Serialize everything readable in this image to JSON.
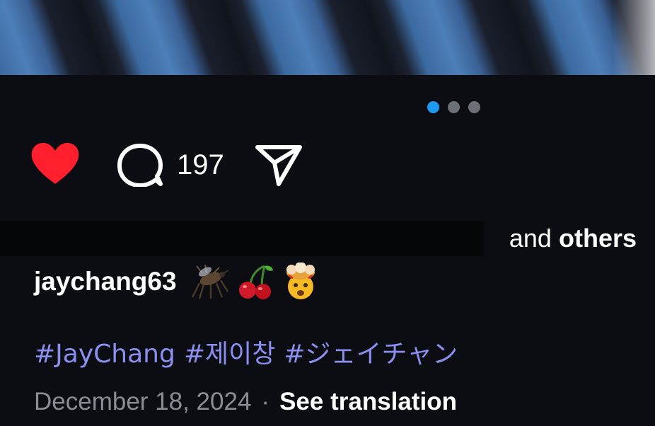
{
  "post": {
    "carousel": {
      "count": 3,
      "active_index": 0
    },
    "actions": {
      "like_icon": "heart-filled-icon",
      "comment_icon": "comment-bubble-icon",
      "comment_count": "197",
      "share_icon": "paper-plane-icon",
      "liked": true,
      "like_color": "#ff1f2d"
    },
    "likes": {
      "and_text": "and ",
      "others_text": "others"
    },
    "caption": {
      "username": "jaychang63",
      "emojis": [
        "mosquito",
        "cherries",
        "exploding-head"
      ]
    },
    "hashtags": [
      "#JayChang",
      "#제이창",
      "#ジェイチャン"
    ],
    "date": "December 18, 2024",
    "separator": "·",
    "see_translation": "See translation"
  },
  "colors": {
    "background": "#0b0d12",
    "hashtag": "#8a8ff0",
    "dot_active": "#1d9bf0",
    "dot_inactive": "#6e7078",
    "muted_text": "#8b8d94"
  }
}
